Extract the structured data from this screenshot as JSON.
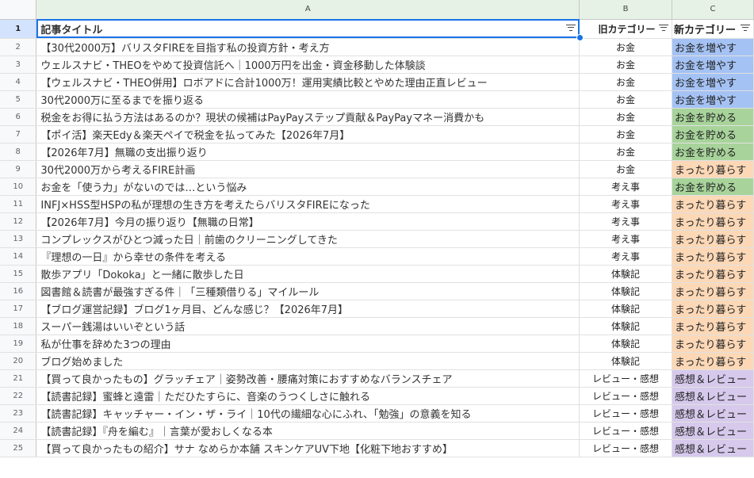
{
  "columns": {
    "a": "A",
    "b": "B",
    "c": "C"
  },
  "header": {
    "row_number": "1",
    "title": "記事タイトル",
    "old_category": "旧カテゴリー",
    "new_category": "新カテゴリー"
  },
  "category_colors": {
    "お金を増やす": "#a4c2f4",
    "お金を貯める": "#a8d49b",
    "まったり暮らす": "#fcd8b7",
    "感想＆レビュー": "#d6c9ec"
  },
  "rows": [
    {
      "num": "2",
      "title": "【30代2000万】バリスタFIREを目指す私の投資方針・考え方",
      "old": "お金",
      "new": "お金を増やす"
    },
    {
      "num": "3",
      "title": "ウェルスナビ・THEOをやめて投資信託へ｜1000万円を出金・資金移動した体験談",
      "old": "お金",
      "new": "お金を増やす"
    },
    {
      "num": "4",
      "title": "【ウェルスナビ・THEO併用】ロボアドに合計1000万！運用実績比較とやめた理由正直レビュー",
      "old": "お金",
      "new": "お金を増やす"
    },
    {
      "num": "5",
      "title": "30代2000万に至るまでを振り返る",
      "old": "お金",
      "new": "お金を増やす"
    },
    {
      "num": "6",
      "title": "税金をお得に払う方法はあるのか？現状の候補はPayPayステップ貢献＆PayPayマネー消費かも",
      "old": "お金",
      "new": "お金を貯める"
    },
    {
      "num": "7",
      "title": "【ポイ活】楽天Edy＆楽天ペイで税金を払ってみた【2026年7月】",
      "old": "お金",
      "new": "お金を貯める"
    },
    {
      "num": "8",
      "title": "【2026年7月】無職の支出振り返り",
      "old": "お金",
      "new": "お金を貯める"
    },
    {
      "num": "9",
      "title": "30代2000万から考えるFIRE計画",
      "old": "お金",
      "new": "まったり暮らす"
    },
    {
      "num": "10",
      "title": "お金を「使う力」がないのでは…という悩み",
      "old": "考え事",
      "new": "お金を貯める"
    },
    {
      "num": "11",
      "title": "INFJ×HSS型HSPの私が理想の生き方を考えたらバリスタFIREになった",
      "old": "考え事",
      "new": "まったり暮らす"
    },
    {
      "num": "12",
      "title": "【2026年7月】今月の振り返り【無職の日常】",
      "old": "考え事",
      "new": "まったり暮らす"
    },
    {
      "num": "13",
      "title": "コンプレックスがひとつ減った日｜前歯のクリーニングしてきた",
      "old": "考え事",
      "new": "まったり暮らす"
    },
    {
      "num": "14",
      "title": "『理想の一日』から幸せの条件を考える",
      "old": "考え事",
      "new": "まったり暮らす"
    },
    {
      "num": "15",
      "title": "散歩アプリ「Dokoka」と一緒に散歩した日",
      "old": "体験記",
      "new": "まったり暮らす"
    },
    {
      "num": "16",
      "title": "図書館＆読書が最強すぎる件｜「三種類借りる」マイルール",
      "old": "体験記",
      "new": "まったり暮らす"
    },
    {
      "num": "17",
      "title": "【ブログ運営記録】ブログ1ヶ月目、どんな感じ？【2026年7月】",
      "old": "体験記",
      "new": "まったり暮らす"
    },
    {
      "num": "18",
      "title": "スーパー銭湯はいいぞという話",
      "old": "体験記",
      "new": "まったり暮らす"
    },
    {
      "num": "19",
      "title": "私が仕事を辞めた3つの理由",
      "old": "体験記",
      "new": "まったり暮らす"
    },
    {
      "num": "20",
      "title": "ブログ始めました",
      "old": "体験記",
      "new": "まったり暮らす"
    },
    {
      "num": "21",
      "title": "【買って良かったもの】グラッチェア｜姿勢改善・腰痛対策におすすめなバランスチェア",
      "old": "レビュー・感想",
      "new": "感想＆レビュー"
    },
    {
      "num": "22",
      "title": "【読書記録】蜜蜂と遠雷｜ただひたすらに、音楽のうつくしさに触れる",
      "old": "レビュー・感想",
      "new": "感想＆レビュー"
    },
    {
      "num": "23",
      "title": "【読書記録】キャッチャー・イン・ザ・ライ｜10代の繊細な心にふれ、「勉強」の意義を知る",
      "old": "レビュー・感想",
      "new": "感想＆レビュー"
    },
    {
      "num": "24",
      "title": "【読書記録】『舟を編む』｜言葉が愛おしくなる本",
      "old": "レビュー・感想",
      "new": "感想＆レビュー"
    },
    {
      "num": "25",
      "title": "【買って良かったもの紹介】サナ なめらか本舗 スキンケアUV下地【化粧下地おすすめ】",
      "old": "レビュー・感想",
      "new": "感想＆レビュー"
    }
  ],
  "group_start_rows": [
    "10",
    "15",
    "21"
  ]
}
